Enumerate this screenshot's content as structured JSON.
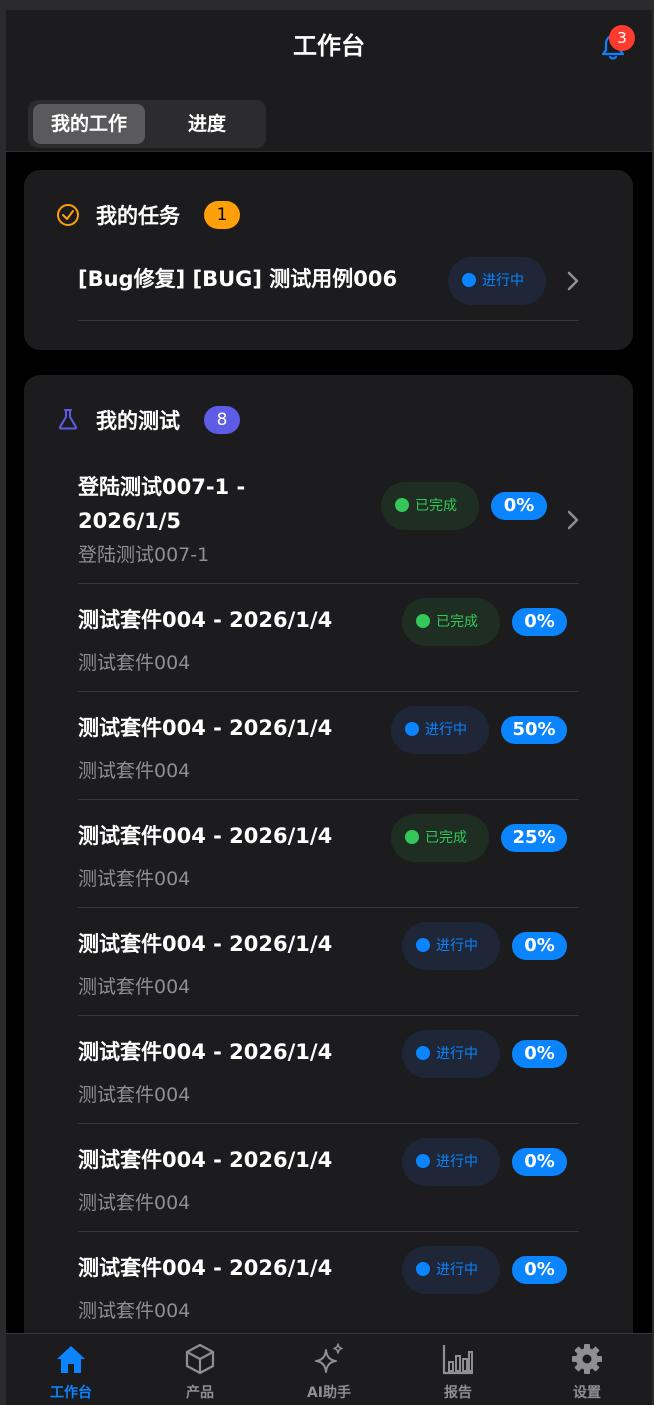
{
  "header": {
    "title": "工作台",
    "notifications": "3",
    "segments": [
      "我的工作",
      "进度"
    ]
  },
  "tasks": {
    "title": "我的任务",
    "count": "1",
    "items": [
      {
        "title": "[Bug修复] [BUG] 测试用例006",
        "status": "进行中"
      }
    ]
  },
  "tests": {
    "title": "我的测试",
    "count": "8",
    "items": [
      {
        "title_line1": "登陆测试007-1 -",
        "title_line2": "2026/1/5",
        "subtitle": "登陆测试007-1",
        "status": "已完成",
        "progress": "0%"
      },
      {
        "title": "测试套件004 - 2026/1/4",
        "subtitle": "测试套件004",
        "status": "已完成",
        "progress": "0%"
      },
      {
        "title": "测试套件004 - 2026/1/4",
        "subtitle": "测试套件004",
        "status": "进行中",
        "progress": "50%"
      },
      {
        "title": "测试套件004 - 2026/1/4",
        "subtitle": "测试套件004",
        "status": "已完成",
        "progress": "25%"
      },
      {
        "title": "测试套件004 - 2026/1/4",
        "subtitle": "测试套件004",
        "status": "进行中",
        "progress": "0%"
      },
      {
        "title": "测试套件004 - 2026/1/4",
        "subtitle": "测试套件004",
        "status": "进行中",
        "progress": "0%"
      },
      {
        "title": "测试套件004 - 2026/1/4",
        "subtitle": "测试套件004",
        "status": "进行中",
        "progress": "0%"
      },
      {
        "title": "测试套件004 - 2026/1/4",
        "subtitle": "测试套件004",
        "status": "进行中",
        "progress": "0%"
      }
    ]
  },
  "tabbar": [
    {
      "label": "工作台",
      "icon": "home-icon",
      "active": true
    },
    {
      "label": "产品",
      "icon": "cube-icon",
      "active": false
    },
    {
      "label": "AI助手",
      "icon": "sparkles-icon",
      "active": false
    },
    {
      "label": "报告",
      "icon": "bar-chart-icon",
      "active": false
    },
    {
      "label": "设置",
      "icon": "gear-icon",
      "active": false
    }
  ],
  "colors": {
    "accent": "#0a84ff",
    "done": "#34c759",
    "task_badge": "#ff9f0a",
    "test_badge": "#5e5ce6",
    "notification_badge": "#ff3b30"
  }
}
